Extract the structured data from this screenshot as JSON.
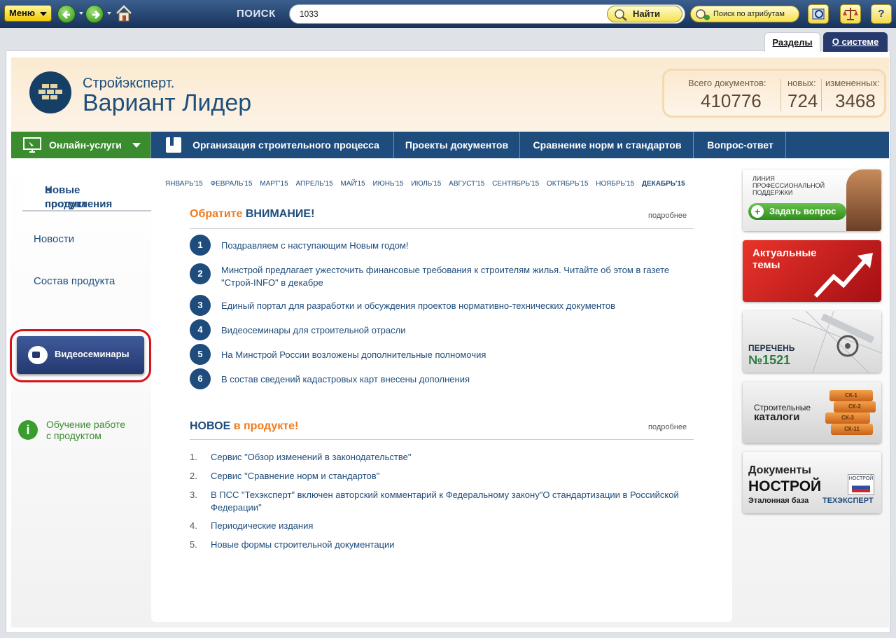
{
  "toolbar": {
    "menu_label": "Меню",
    "search_label": "ПОИСК",
    "search_value": "1033",
    "find_label": "Найти",
    "attr_search_label": "Поиск по атрибутам",
    "help_label": "?"
  },
  "tabs": {
    "sections": "Разделы",
    "about": "О системе"
  },
  "header": {
    "logo_line1": "Стройэксперт.",
    "logo_line2": "Вариант Лидер",
    "total_label": "Всего документов:",
    "total_value": "410776",
    "new_label": "новых:",
    "new_value": "724",
    "changed_label": "измененных:",
    "changed_value": "3468"
  },
  "nav": {
    "online": "Онлайн-услуги",
    "org": "Организация строительного процесса",
    "projects": "Проекты документов",
    "compare": "Сравнение норм и стандартов",
    "qa": "Вопрос-ответ"
  },
  "sidebar": {
    "new_items_line1": "Новые поступления",
    "new_items_line2": "в продукт",
    "news": "Новости",
    "composition": "Состав продукта",
    "video": "Видеосеминары",
    "learn_line1": "Обучение работе",
    "learn_line2": "с продуктом"
  },
  "months": [
    "ЯНВАРЬ'15",
    "ФЕВРАЛЬ'15",
    "МАРТ'15",
    "АПРЕЛЬ'15",
    "МАЙ'15",
    "ИЮНЬ'15",
    "ИЮЛЬ'15",
    "АВГУСТ'15",
    "СЕНТЯБРЬ'15",
    "ОКТЯБРЬ'15",
    "НОЯБРЬ'15",
    "ДЕКАБРЬ'15"
  ],
  "attention": {
    "title_orange": "Обратите",
    "title_blue": "ВНИМАНИЕ!",
    "more": "подробнее",
    "items": [
      {
        "num": "1",
        "text": "Поздравляем с наступающим Новым годом!"
      },
      {
        "num": "2",
        "text": "Минстрой предлагает ужесточить финансовые требования к строителям жилья. Читайте об этом в газете \"Строй-INFO\" в декабре"
      },
      {
        "num": "3",
        "text": "Единый портал для разработки и обсуждения проектов нормативно-технических документов"
      },
      {
        "num": "4",
        "text": "Видеосеминары для строительной отрасли"
      },
      {
        "num": "5",
        "text": "На Минстрой России возложены дополнительные полномочия"
      },
      {
        "num": "6",
        "text": "В состав сведений кадастровых карт внесены дополнения"
      }
    ]
  },
  "news_block": {
    "title_blue": "НОВОЕ",
    "title_orange": "в продукте!",
    "more": "подробнее",
    "items": [
      {
        "num": "1.",
        "text": "Сервис \"Обзор изменений в законодательстве\""
      },
      {
        "num": "2.",
        "text": "Сервис \"Сравнение норм и стандартов\""
      },
      {
        "num": "3.",
        "text": "В ПСС \"Техэксперт\" включен авторский комментарий к Федеральному закону\"О стандартизации в Российской Федерации\""
      },
      {
        "num": "4.",
        "text": "Периодические издания"
      },
      {
        "num": "5.",
        "text": "Новые формы строительной документации"
      }
    ]
  },
  "banners": {
    "support_text": "ЛИНИЯ ПРОФЕССИОНАЛЬНОЙ ПОДДЕРЖКИ",
    "support_button": "Задать вопрос",
    "topics": "Актуальные темы",
    "list_line1": "ПЕРЕЧЕНЬ",
    "list_line2": "№1521",
    "catalog_line1": "Строительные",
    "catalog_line2": "каталоги",
    "catalog_books": [
      "СК-1",
      "СК-2",
      "СК-3",
      "СК-11"
    ],
    "nostroy_line1": "Документы",
    "nostroy_line2": "НОСТРОЙ",
    "nostroy_line3": "Эталонная база",
    "nostroy_badge": "НОСТРОЙ",
    "nostroy_brand": "ТЕХЭКСПЕРТ"
  }
}
